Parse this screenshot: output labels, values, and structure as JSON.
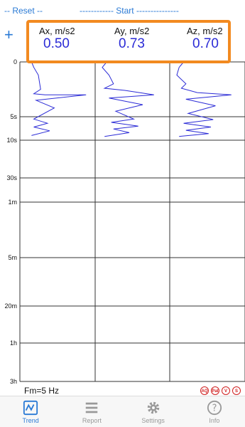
{
  "header": {
    "reset_label": "-- Reset --",
    "start_label": "------------ Start ---------------",
    "add_label": "+"
  },
  "channels": [
    {
      "label": "Ax, m/s2",
      "value": "0.50",
      "ticks": [
        "1",
        "2",
        "3"
      ]
    },
    {
      "label": "Ay, m/s2",
      "value": "0.73",
      "ticks": [
        "1",
        "2"
      ]
    },
    {
      "label": "Az, m/s2",
      "value": "0.70",
      "ticks": [
        "1",
        "2"
      ]
    }
  ],
  "colors": {
    "accent": "#2a7ad5",
    "highlight": "#f28a20",
    "trace": "#2b2bd6"
  },
  "time_labels": [
    "0",
    "5s",
    "10s",
    "30s",
    "1m",
    "5m",
    "20m",
    "1h",
    "3h"
  ],
  "footer": {
    "sampling": "Fm=5 Hz",
    "badges": [
      "AQ",
      "Pat",
      "V",
      "S"
    ]
  },
  "tabs": [
    {
      "label": "Trend",
      "icon": "trend-icon"
    },
    {
      "label": "Report",
      "icon": "list-icon"
    },
    {
      "label": "Settings",
      "icon": "gear-icon"
    },
    {
      "label": "Info",
      "icon": "info-icon"
    }
  ],
  "chart_data": {
    "type": "line",
    "y_axis": "time (log scale)",
    "series": [
      {
        "x": [
          0.2,
          0.3,
          0.5,
          0.6,
          0.3,
          0.8,
          2.6,
          0.4,
          1.2,
          0.3,
          0.9,
          0.3,
          1.0,
          0.2
        ],
        "y": [
          0,
          5,
          12,
          25,
          29,
          30,
          30,
          35,
          42,
          55,
          64,
          72,
          80,
          90
        ]
      },
      {
        "x": [
          0.2,
          0.0,
          0.3,
          0.5,
          0.1,
          1.0,
          2.3,
          0.3,
          1.8,
          0.6,
          1.4,
          0.4,
          1.6,
          0.5,
          1.2,
          0.1
        ],
        "y": [
          0,
          5,
          12,
          20,
          24,
          26,
          30,
          33,
          39,
          45,
          55,
          62,
          70,
          76,
          84,
          92
        ]
      },
      {
        "x": [
          0.3,
          0.1,
          0.0,
          0.4,
          0.2,
          0.9,
          2.4,
          0.4,
          1.7,
          0.5,
          1.6,
          0.3,
          1.5,
          0.4,
          1.4,
          0.1
        ],
        "y": [
          0,
          5,
          12,
          20,
          24,
          28,
          30,
          34,
          40,
          47,
          56,
          64,
          72,
          79,
          86,
          92
        ]
      }
    ]
  }
}
